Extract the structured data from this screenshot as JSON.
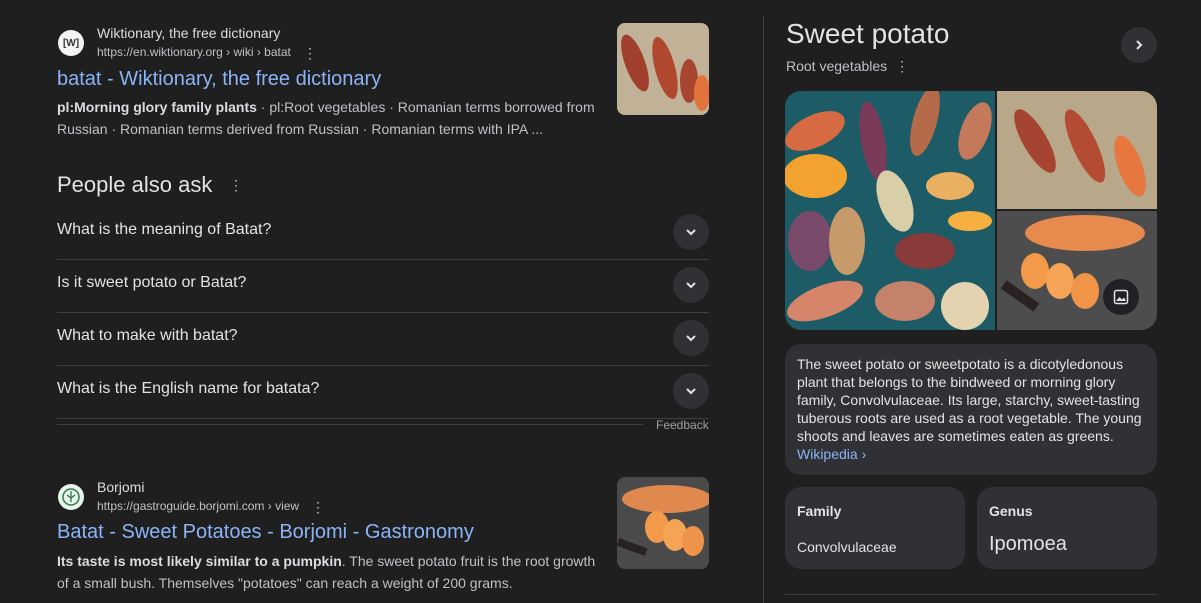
{
  "results": [
    {
      "site_name": "Wiktionary, the free dictionary",
      "url": "https://en.wiktionary.org › wiki › batat",
      "favicon_text": "[W]",
      "title": "batat - Wiktionary, the free dictionary",
      "snippet_bold": "pl:Morning glory family plants",
      "snippet_rest": " · pl:Root vegetables · Romanian terms borrowed from Russian · Romanian terms derived from Russian · Romanian terms with IPA ..."
    },
    {
      "site_name": "Borjomi",
      "url": "https://gastroguide.borjomi.com › view",
      "title": "Batat - Sweet Potatoes - Borjomi - Gastronomy",
      "snippet_bold": "Its taste is most likely similar to a pumpkin",
      "snippet_rest": ". The sweet potato fruit is the root growth of a small bush. Themselves \"potatoes\" can reach a weight of 200 grams."
    }
  ],
  "people_also_ask": {
    "title": "People also ask",
    "questions": [
      "What is the meaning of Batat?",
      "Is it sweet potato or Batat?",
      "What to make with batat?",
      "What is the English name for batata?"
    ],
    "feedback": "Feedback"
  },
  "knowledge_panel": {
    "title": "Sweet potato",
    "subtitle": "Root vegetables",
    "description": "The sweet potato or sweetpotato is a dicotyledonous plant that belongs to the bindweed or morning glory family, Convolvulaceae. Its large, starchy, sweet-tasting tuberous roots are used as a root vegetable. The young shoots and leaves are sometimes eaten as greens.",
    "source_link": "Wikipedia ›",
    "facts": [
      {
        "label": "Family",
        "value": "Convolvulaceae"
      },
      {
        "label": "Genus",
        "value": "Ipomoea"
      }
    ]
  },
  "icons": {
    "more": "kebab-vertical-icon",
    "expand": "chevron-down-icon",
    "next": "chevron-right-icon",
    "images": "image-icon"
  },
  "colors": {
    "background": "#1f1f1f",
    "link": "#8ab4f8",
    "card": "#303134"
  }
}
